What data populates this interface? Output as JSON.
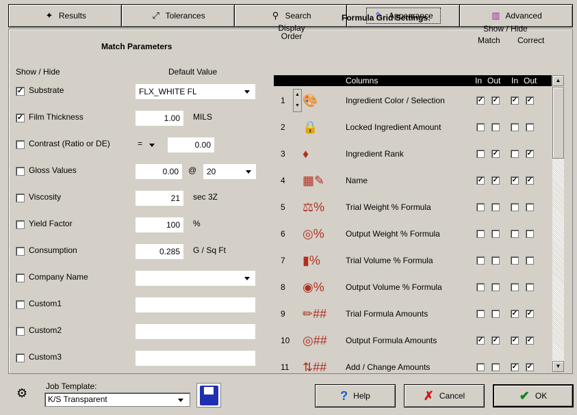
{
  "tabs": [
    {
      "label": "Results",
      "icon": "results-icon"
    },
    {
      "label": "Tolerances",
      "icon": "tolerances-icon"
    },
    {
      "label": "Search",
      "icon": "search-icon"
    },
    {
      "label": "Appearance",
      "icon": "appearance-icon",
      "active": true
    },
    {
      "label": "Advanced",
      "icon": "advanced-icon"
    }
  ],
  "match": {
    "title": "Match Parameters",
    "show_hide_header": "Show / Hide",
    "default_value_header": "Default Value",
    "rows": [
      {
        "label": "Substrate",
        "checked": true,
        "value": "FLX_WHITE FL"
      },
      {
        "label": "Film Thickness",
        "checked": true,
        "value": "1.00",
        "unit": "MILS"
      },
      {
        "label": "Contrast (Ratio or DE)",
        "checked": false,
        "operator": "=",
        "value": "0.00"
      },
      {
        "label": "Gloss Values",
        "checked": false,
        "value": "0.00",
        "at": "@",
        "angle": "20"
      },
      {
        "label": "Viscosity",
        "checked": false,
        "value": "21",
        "unit": "sec 3Z"
      },
      {
        "label": "Yield Factor",
        "checked": false,
        "value": "100",
        "unit": "%"
      },
      {
        "label": "Consumption",
        "checked": false,
        "value": "0.285",
        "unit": "G / Sq Ft"
      },
      {
        "label": "Company Name",
        "checked": false,
        "value": ""
      },
      {
        "label": "Custom1",
        "checked": false,
        "value": ""
      },
      {
        "label": "Custom2",
        "checked": false,
        "value": ""
      },
      {
        "label": "Custom3",
        "checked": false,
        "value": ""
      }
    ]
  },
  "grid": {
    "title": "Formula Grid Settings:",
    "display_order_line1": "Display",
    "display_order_line2": "Order",
    "show_hide": "Show / Hide",
    "match": "Match",
    "correct": "Correct",
    "col_header": "Columns",
    "in1": "In",
    "out1": "Out",
    "in2": "In",
    "out2": "Out",
    "rows": [
      {
        "num": "1",
        "label": "Ingredient Color / Selection",
        "icon": "color-selection-icon",
        "checks": [
          true,
          true,
          true,
          true
        ]
      },
      {
        "num": "2",
        "label": "Locked Ingredient Amount",
        "icon": "lock-icon",
        "checks": [
          false,
          false,
          false,
          false
        ]
      },
      {
        "num": "3",
        "label": "Ingredient Rank",
        "icon": "rank-icon",
        "checks": [
          false,
          true,
          false,
          true
        ]
      },
      {
        "num": "4",
        "label": "Name",
        "icon": "name-icon",
        "checks": [
          true,
          true,
          true,
          true
        ]
      },
      {
        "num": "5",
        "label": "Trial Weight % Formula",
        "icon": "trial-weight-icon",
        "checks": [
          false,
          false,
          false,
          false
        ]
      },
      {
        "num": "6",
        "label": "Output Weight % Formula",
        "icon": "output-weight-icon",
        "checks": [
          false,
          false,
          false,
          false
        ]
      },
      {
        "num": "7",
        "label": "Trial Volume % Formula",
        "icon": "trial-volume-icon",
        "checks": [
          false,
          false,
          false,
          false
        ]
      },
      {
        "num": "8",
        "label": "Output Volume % Formula",
        "icon": "output-volume-icon",
        "checks": [
          false,
          false,
          false,
          false
        ]
      },
      {
        "num": "9",
        "label": "Trial Formula Amounts",
        "icon": "trial-amounts-icon",
        "checks": [
          false,
          false,
          true,
          true
        ]
      },
      {
        "num": "10",
        "label": "Output Formula Amounts",
        "icon": "output-amounts-icon",
        "checks": [
          true,
          true,
          true,
          true
        ]
      },
      {
        "num": "11",
        "label": "Add / Change Amounts",
        "icon": "add-change-icon",
        "checks": [
          false,
          false,
          true,
          true
        ]
      }
    ]
  },
  "bottom": {
    "job_template_label": "Job Template:",
    "job_template_value": "K/S Transparent",
    "help": "Help",
    "cancel": "Cancel",
    "ok": "OK"
  }
}
